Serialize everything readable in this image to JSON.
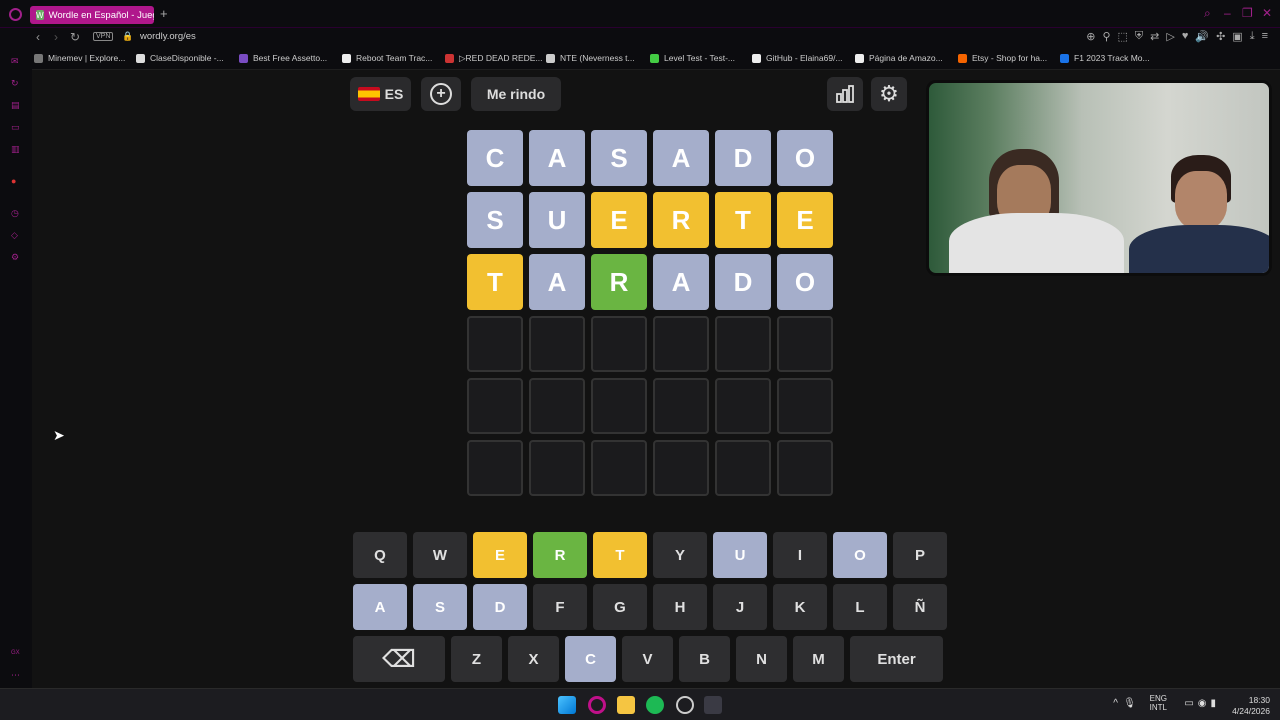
{
  "browser": {
    "tab_title": "Wordle en Español - Juego",
    "tab_favicon": "W",
    "url": "wordly.org/es",
    "vpn_label": "VPN",
    "bookmarks": [
      {
        "label": "Minemev | Explore...",
        "color": "#777"
      },
      {
        "label": "ClaseDisponible -...",
        "color": "#ddd"
      },
      {
        "label": "Best Free Assetto...",
        "color": "#7a4cc2"
      },
      {
        "label": "Reboot Team Trac...",
        "color": "#eee"
      },
      {
        "label": "▷RED DEAD REDE...",
        "color": "#c33"
      },
      {
        "label": "NTE (Neverness t...",
        "color": "#ccc"
      },
      {
        "label": "Level Test - Test-...",
        "color": "#4c4"
      },
      {
        "label": "GitHub - Elaina69/...",
        "color": "#eee"
      },
      {
        "label": "Página de Amazo...",
        "color": "#eee"
      },
      {
        "label": "Etsy - Shop for ha...",
        "color": "#f56400"
      },
      {
        "label": "F1 2023 Track Mo...",
        "color": "#1a73e8"
      }
    ]
  },
  "game": {
    "language_label": "ES",
    "give_up_label": "Me rindo",
    "board": [
      [
        {
          "l": "C",
          "s": "absent"
        },
        {
          "l": "A",
          "s": "absent"
        },
        {
          "l": "S",
          "s": "absent"
        },
        {
          "l": "A",
          "s": "absent"
        },
        {
          "l": "D",
          "s": "absent"
        },
        {
          "l": "O",
          "s": "absent"
        }
      ],
      [
        {
          "l": "S",
          "s": "absent"
        },
        {
          "l": "U",
          "s": "absent"
        },
        {
          "l": "E",
          "s": "present"
        },
        {
          "l": "R",
          "s": "present"
        },
        {
          "l": "T",
          "s": "present"
        },
        {
          "l": "E",
          "s": "present"
        }
      ],
      [
        {
          "l": "T",
          "s": "present"
        },
        {
          "l": "A",
          "s": "absent"
        },
        {
          "l": "R",
          "s": "correct"
        },
        {
          "l": "A",
          "s": "absent"
        },
        {
          "l": "D",
          "s": "absent"
        },
        {
          "l": "O",
          "s": "absent"
        }
      ],
      [
        {
          "l": "",
          "s": "empty"
        },
        {
          "l": "",
          "s": "empty"
        },
        {
          "l": "",
          "s": "empty"
        },
        {
          "l": "",
          "s": "empty"
        },
        {
          "l": "",
          "s": "empty"
        },
        {
          "l": "",
          "s": "empty"
        }
      ],
      [
        {
          "l": "",
          "s": "empty"
        },
        {
          "l": "",
          "s": "empty"
        },
        {
          "l": "",
          "s": "empty"
        },
        {
          "l": "",
          "s": "empty"
        },
        {
          "l": "",
          "s": "empty"
        },
        {
          "l": "",
          "s": "empty"
        }
      ],
      [
        {
          "l": "",
          "s": "empty"
        },
        {
          "l": "",
          "s": "empty"
        },
        {
          "l": "",
          "s": "empty"
        },
        {
          "l": "",
          "s": "empty"
        },
        {
          "l": "",
          "s": "empty"
        },
        {
          "l": "",
          "s": "empty"
        }
      ]
    ],
    "keyboard": [
      [
        {
          "k": "Q",
          "s": ""
        },
        {
          "k": "W",
          "s": ""
        },
        {
          "k": "E",
          "s": "present"
        },
        {
          "k": "R",
          "s": "correct"
        },
        {
          "k": "T",
          "s": "present"
        },
        {
          "k": "Y",
          "s": ""
        },
        {
          "k": "U",
          "s": "absent"
        },
        {
          "k": "I",
          "s": ""
        },
        {
          "k": "O",
          "s": "absent"
        },
        {
          "k": "P",
          "s": ""
        }
      ],
      [
        {
          "k": "A",
          "s": "absent"
        },
        {
          "k": "S",
          "s": "absent"
        },
        {
          "k": "D",
          "s": "absent"
        },
        {
          "k": "F",
          "s": ""
        },
        {
          "k": "G",
          "s": ""
        },
        {
          "k": "H",
          "s": ""
        },
        {
          "k": "J",
          "s": ""
        },
        {
          "k": "K",
          "s": ""
        },
        {
          "k": "L",
          "s": ""
        },
        {
          "k": "Ñ",
          "s": ""
        }
      ],
      [
        {
          "k": "⌫",
          "s": "",
          "wide": "wide1"
        },
        {
          "k": "Z",
          "s": ""
        },
        {
          "k": "X",
          "s": ""
        },
        {
          "k": "C",
          "s": "absent"
        },
        {
          "k": "V",
          "s": ""
        },
        {
          "k": "B",
          "s": ""
        },
        {
          "k": "N",
          "s": ""
        },
        {
          "k": "M",
          "s": ""
        },
        {
          "k": "Enter",
          "s": "",
          "wide": "wide2"
        }
      ]
    ],
    "colors": {
      "absent": "#a5aecb",
      "present": "#f2c030",
      "correct": "#6ab542"
    }
  },
  "taskbar": {
    "lang_top": "ENG",
    "lang_bottom": "INTL",
    "time": "18:30",
    "date": "4/24/2026"
  }
}
